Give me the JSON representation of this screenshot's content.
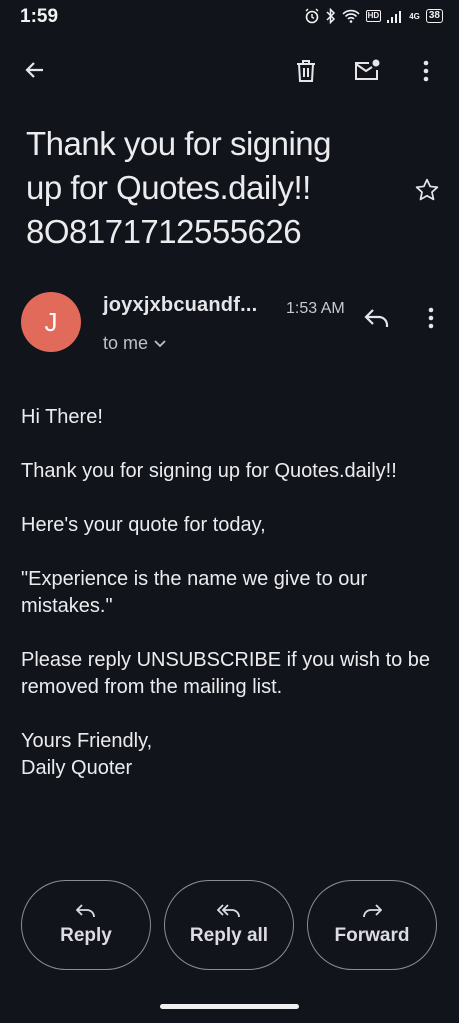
{
  "status_bar": {
    "time": "1:59",
    "network": "4G",
    "hd": "HD",
    "battery": "38"
  },
  "toolbar": {
    "back_icon": "arrow-left-icon",
    "delete_icon": "trash-icon",
    "mark_unread_icon": "mail-unread-icon",
    "more_icon": "more-vertical-icon"
  },
  "email": {
    "subject": "Thank you for signing up for Quotes.daily!! 8O817171255 5626",
    "subject_line1": "Thank you for signing",
    "subject_line2": "up for Quotes.daily!!",
    "subject_line3": "8O8171712555626",
    "sender_initial": "J",
    "sender": "joyxjxbcuandf...",
    "time": "1:53 AM",
    "recipient": "to me",
    "avatar_color": "#e26a5a",
    "body": [
      "Hi There!",
      "Thank you for signing up for Quotes.daily!!",
      "Here's your quote for today,",
      "\"Experience is the name we give to our mistakes.\"",
      "Please reply UNSUBSCRIBE if you wish to be removed from the mailing list."
    ],
    "signoff_line1": "Yours Friendly,",
    "signoff_line2": "Daily Quoter"
  },
  "actions": {
    "reply": "Reply",
    "reply_all": "Reply all",
    "forward": "Forward"
  },
  "colors": {
    "background": "#11141b",
    "text": "#ececef",
    "outline": "#8a8d96"
  }
}
